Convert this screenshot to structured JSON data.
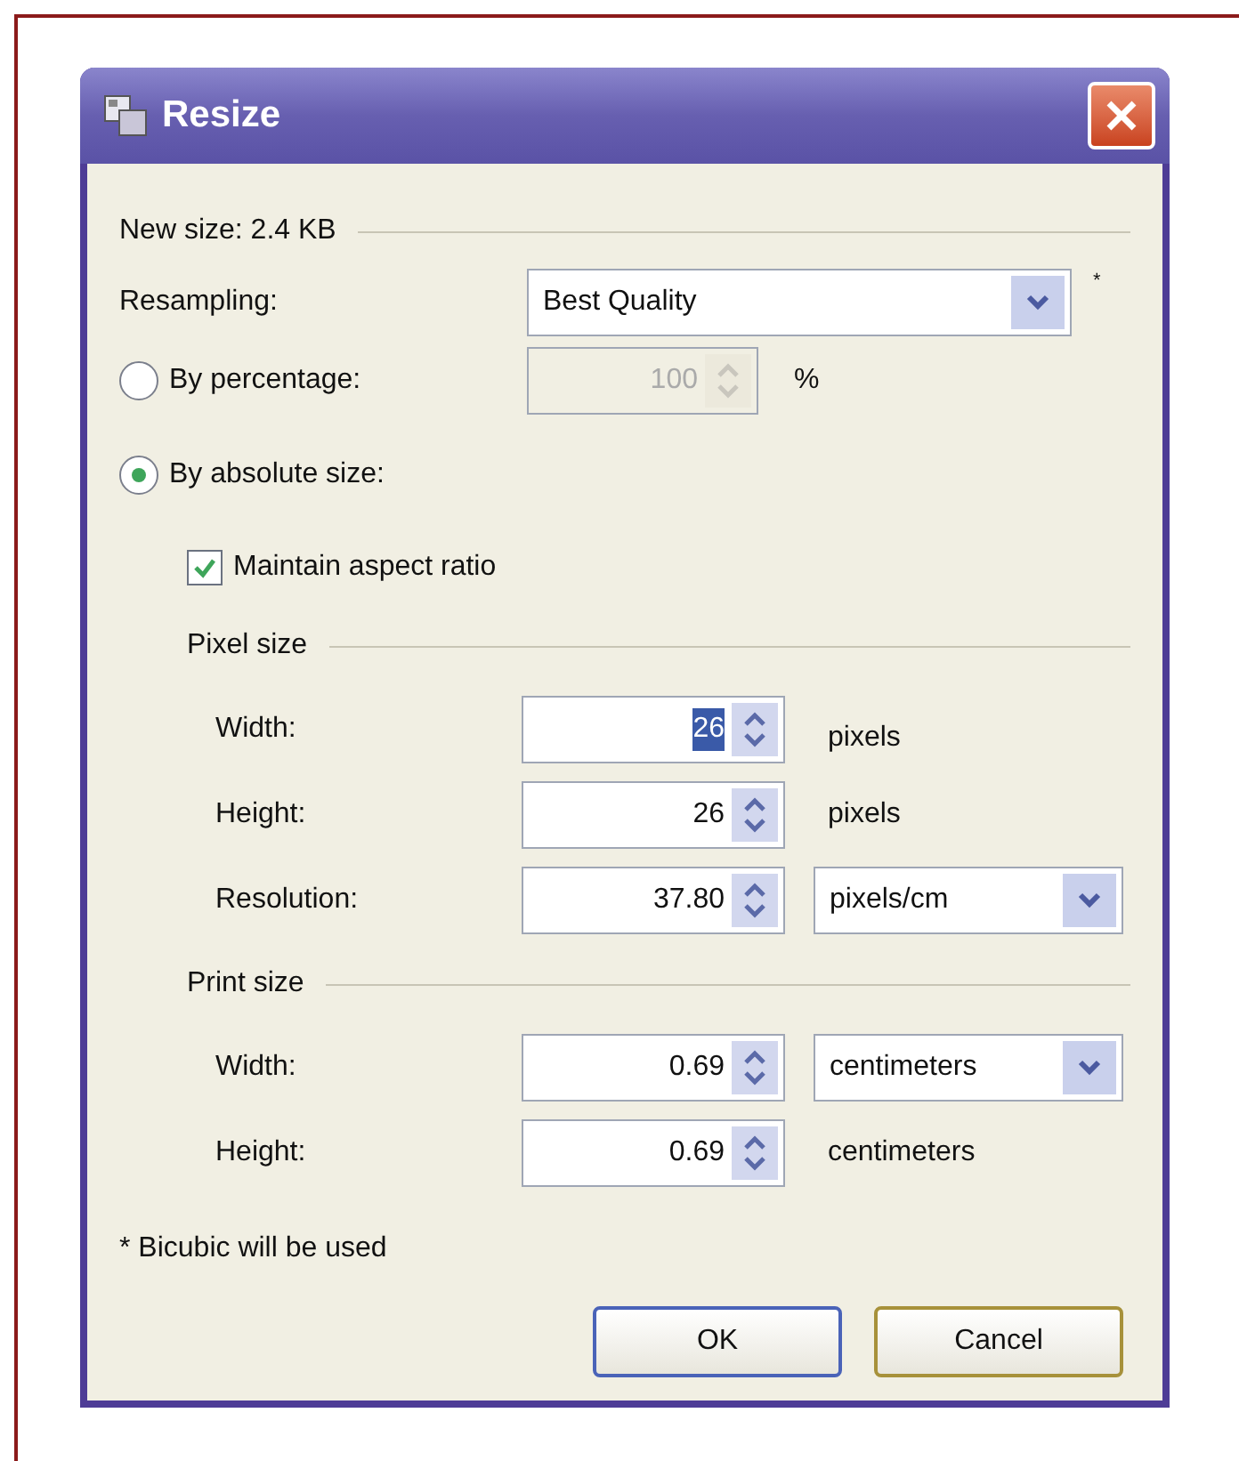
{
  "window": {
    "title": "Resize"
  },
  "new_size": "New size: 2.4 KB",
  "resampling": {
    "label": "Resampling:",
    "value": "Best Quality",
    "note": "*"
  },
  "modes": [
    {
      "label": "By percentage:",
      "selected": false
    },
    {
      "label": "By absolute size:",
      "selected": true
    }
  ],
  "percentage": {
    "value": "100",
    "unit": "%",
    "disabled": true
  },
  "maintain_aspect": {
    "label": "Maintain aspect ratio",
    "checked": true
  },
  "sections": [
    {
      "title": "Pixel size",
      "rows": [
        {
          "label": "Width:",
          "value": "26",
          "highlighted": true,
          "kind": "text",
          "unit": "pixels"
        },
        {
          "label": "Height:",
          "value": "26",
          "highlighted": false,
          "kind": "text",
          "unit": "pixels"
        },
        {
          "label": "Resolution:",
          "value": "37.80",
          "highlighted": false,
          "kind": "dropdown",
          "unit": "pixels/cm"
        }
      ]
    },
    {
      "title": "Print size",
      "rows": [
        {
          "label": "Width:",
          "value": "0.69",
          "highlighted": false,
          "kind": "dropdown",
          "unit": "centimeters"
        },
        {
          "label": "Height:",
          "value": "0.69",
          "highlighted": false,
          "kind": "text",
          "unit": "centimeters"
        }
      ]
    }
  ],
  "footnote": "* Bicubic will be used",
  "buttons": [
    {
      "label": "OK",
      "default": true
    },
    {
      "label": "Cancel",
      "default": false
    }
  ]
}
